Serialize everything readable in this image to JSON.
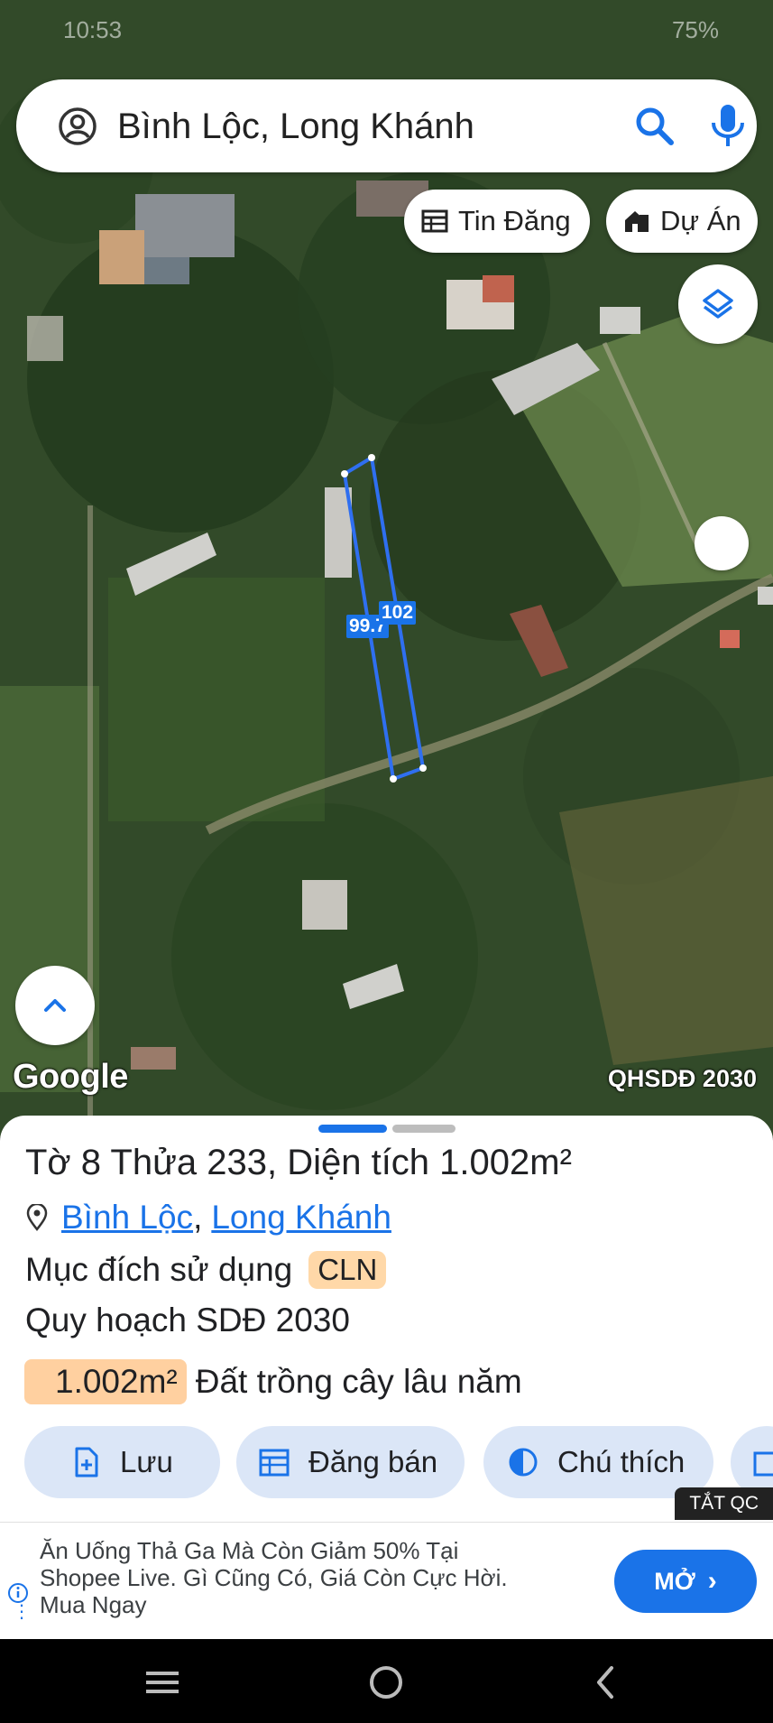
{
  "status": {
    "time": "10:53",
    "battery": "75%"
  },
  "search": {
    "query": "Bình Lộc, Long Khánh"
  },
  "chips": {
    "tin_dang": "Tin Đăng",
    "du_an": "Dự Án"
  },
  "map": {
    "attribution": "Google",
    "overlay_label": "QHSDĐ 2030",
    "parcel_edges": [
      "99.7",
      "102"
    ]
  },
  "parcel": {
    "title": "Tờ 8 Thửa 233, Diện tích 1.002m²",
    "ward": "Bình Lộc",
    "separator": ",",
    "city": "Long Khánh",
    "usage_label": "Mục đích sử dụng",
    "usage_code": "CLN",
    "plan_label": "Quy hoạch SDĐ 2030",
    "area_value": "1.002m²",
    "area_type": "Đất trồng cây lâu năm"
  },
  "actions": {
    "save": "Lưu",
    "post": "Đăng bán",
    "legend": "Chú thích"
  },
  "ads": {
    "hide_label": "TẮT QC",
    "text": "Ăn Uống Thả Ga Mà Còn Giảm 50% Tại Shopee Live. Gì Cũng Có, Giá Còn Cực Hời. Mua Ngay",
    "cta": "MỞ"
  },
  "colors": {
    "accent": "#1a73e8",
    "badge_orange": "#ffd8a8",
    "chip_bg": "#dbe6f7"
  },
  "icons": [
    "account-icon",
    "search-icon",
    "mic-icon",
    "table-icon",
    "house-icon",
    "layers-icon",
    "chevron-up-icon",
    "pin-icon",
    "file-plus-icon",
    "calendar-icon",
    "contrast-icon",
    "info-icon",
    "menu-icon",
    "home-icon",
    "back-icon"
  ]
}
